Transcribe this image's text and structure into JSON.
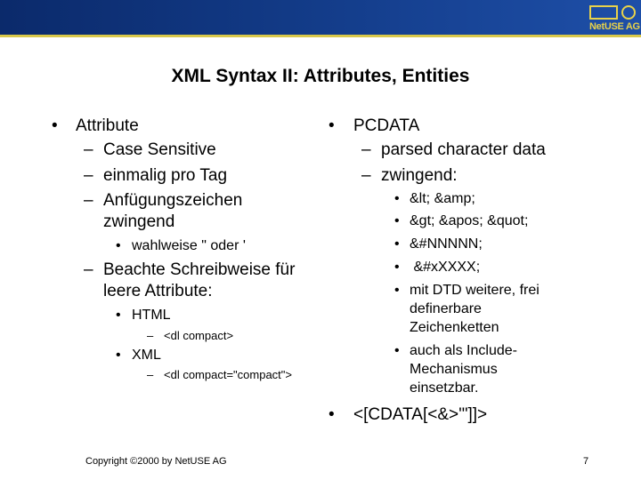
{
  "header": {
    "logo_text": "NetUSE AG",
    "colors": {
      "bar": "#123a86",
      "accent": "#e8d24a"
    }
  },
  "title": "XML Syntax II: Attributes, Entities",
  "left_column": {
    "attribute": "Attribute",
    "case_sensitive": "Case Sensitive",
    "einmalig": "einmalig pro Tag",
    "anf_line1": "Anfügungszeichen",
    "anf_line2": "zwingend",
    "wahlweise": "wahlweise \" oder '",
    "beachte_line1": "Beachte Schreibweise für",
    "beachte_line2": "leere Attribute:",
    "html": "HTML",
    "dl_compact": "<dl compact>",
    "xml": "XML",
    "dl_compact_xml": "<dl compact=\"compact\">"
  },
  "right_column": {
    "pcdata": "PCDATA",
    "parsed": "parsed character data",
    "zwingend": "zwingend:",
    "e1": "&lt; &amp;",
    "e2": "&gt; &apos; &quot;",
    "e3": "&#NNNNN;",
    "e4": " &#xXXXX;",
    "dtd_line1": "mit DTD weitere, frei",
    "dtd_line2": "definerbare",
    "dtd_line3": "Zeichenketten",
    "include_line1": "auch als Include-",
    "include_line2": "Mechanismus",
    "include_line3": "einsetzbar.",
    "cdata": "<[CDATA[<&>'\"]]>"
  },
  "footer": {
    "copyright": "Copyright ©2000 by NetUSE AG",
    "page_number": "7"
  },
  "glyphs": {
    "bullet": "•",
    "dash": "–"
  }
}
